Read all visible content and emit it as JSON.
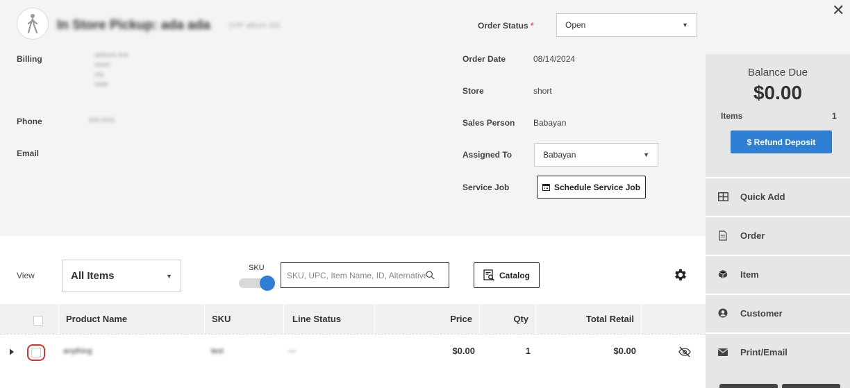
{
  "header": {
    "title": "In Store Pickup: ada ada",
    "subtitle": "(VIP album 00)",
    "close_label": "✕"
  },
  "customer": {
    "billing_label": "Billing",
    "billing_lines": [
      "address line",
      "street",
      "city",
      "state"
    ],
    "phone_label": "Phone",
    "phone_value": "555-0101",
    "email_label": "Email"
  },
  "order": {
    "status_label": "Order Status",
    "status_required": "*",
    "status_value": "Open",
    "date_label": "Order Date",
    "date_value": "08/14/2024",
    "store_label": "Store",
    "store_value": "short",
    "sales_person_label": "Sales Person",
    "sales_person_value": "Babayan",
    "assigned_to_label": "Assigned To",
    "assigned_to_value": "Babayan",
    "service_job_label": "Service Job",
    "schedule_button": "Schedule Service Job"
  },
  "balance": {
    "title": "Balance Due",
    "amount": "$0.00",
    "items_label": "Items",
    "items_value": "1",
    "refund_button": "$ Refund Deposit"
  },
  "side_menu": [
    {
      "label": "Quick Add",
      "icon": "grid-icon"
    },
    {
      "label": "Order",
      "icon": "document-icon"
    },
    {
      "label": "Item",
      "icon": "box-icon"
    },
    {
      "label": "Customer",
      "icon": "user-circle-icon"
    },
    {
      "label": "Print/Email",
      "icon": "envelope-icon"
    }
  ],
  "toolbar": {
    "view_label": "View",
    "view_value": "All Items",
    "sku_label": "SKU",
    "search_placeholder": "SKU, UPC, Item Name, ID, Alternative I",
    "catalog_button": "Catalog"
  },
  "table": {
    "columns": [
      "Product Name",
      "SKU",
      "Line Status",
      "Price",
      "Qty",
      "Total Retail"
    ],
    "rows": [
      {
        "product_name": "anything",
        "sku": "test",
        "line_status": "—",
        "price": "$0.00",
        "qty": "1",
        "total_retail": "$0.00"
      }
    ]
  },
  "colors": {
    "accent": "#2f7fd4",
    "highlight_ring": "#d9342b"
  }
}
